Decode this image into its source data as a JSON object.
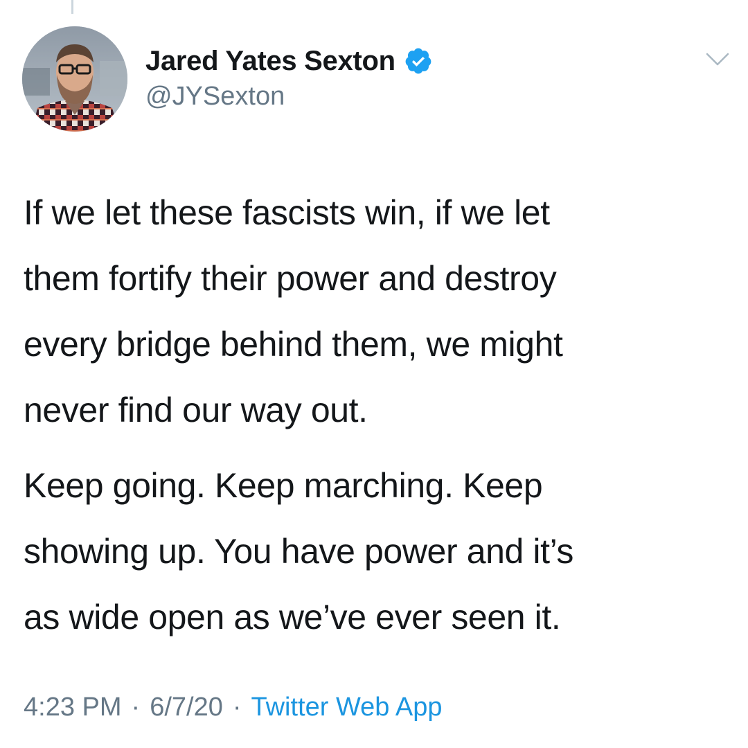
{
  "tweet": {
    "author": {
      "display_name": "Jared Yates Sexton",
      "handle": "@JYSexton",
      "verified": true,
      "verified_icon": "verified-badge-icon",
      "avatar": "profile-photo"
    },
    "menu_icon": "chevron-down-icon",
    "paragraphs": [
      "If we let these fascists win, if we let\nthem fortify their power and destroy\nevery bridge behind them, we might\nnever find our way out.",
      "Keep going. Keep marching. Keep\nshowing up. You have power and it’s\nas wide open as we’ve ever seen it."
    ],
    "time": "4:23 PM",
    "separator": "·",
    "date": "6/7/20",
    "source": "Twitter Web App"
  },
  "colors": {
    "text": "#14171a",
    "secondary": "#657786",
    "link": "#1b95e0",
    "verified": "#1da1f2",
    "thread_line": "#ccd6dd"
  }
}
